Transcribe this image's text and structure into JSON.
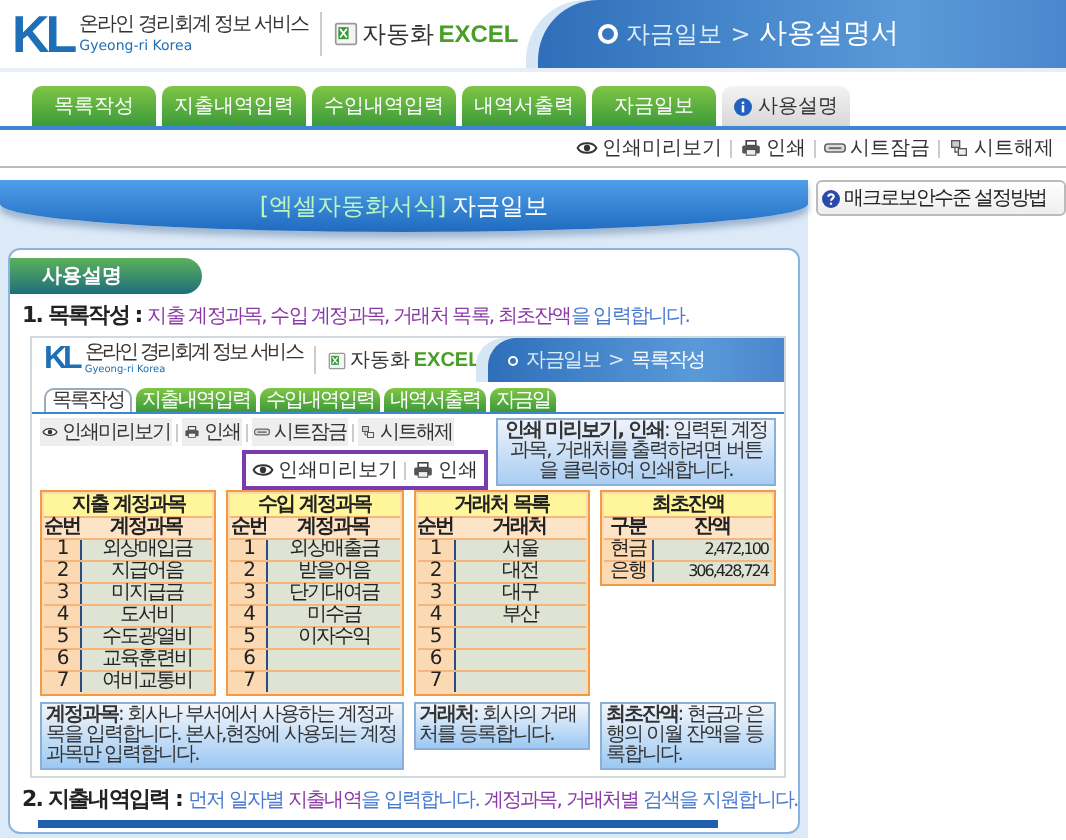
{
  "header": {
    "logo": "KL",
    "tagline": "온라인 경리회계 정보 서비스",
    "brand_sub": "Gyeong-ri Korea",
    "product_prefix": "자동화",
    "product_suffix": "EXCEL",
    "breadcrumb": [
      "자금일보",
      "사용설명서"
    ],
    "separator": ">"
  },
  "tabs": [
    {
      "label": "목록작성",
      "selected": false
    },
    {
      "label": "지출내역입력",
      "selected": false
    },
    {
      "label": "수입내역입력",
      "selected": false
    },
    {
      "label": "내역서출력",
      "selected": false
    },
    {
      "label": "자금일보",
      "selected": false
    },
    {
      "label": "사용설명",
      "selected": true
    }
  ],
  "toolbar": [
    {
      "label": "인쇄미리보기",
      "kind": "eye"
    },
    {
      "label": "인쇄",
      "kind": "printer"
    },
    {
      "label": "시트잠금",
      "kind": "lock"
    },
    {
      "label": "시트해제",
      "kind": "unlock"
    }
  ],
  "side_button": "매크로보안수준 설정방법",
  "banner": {
    "prefix": "[엑셀자동화서식]",
    "title": "자금일보"
  },
  "section_pill": "사용설명",
  "steps": [
    {
      "number": "1.",
      "title": "목록작성",
      "colon": ":",
      "description": [
        {
          "text": "지출 계정과목, 수입 계정과목, 거래처 목록, 최초잔액",
          "emphasis": true
        },
        {
          "text": "을 입력합니다.",
          "emphasis": false
        }
      ],
      "example": {
        "header": {
          "logo": "KL",
          "tagline": "온라인 경리회계 정보 서비스",
          "brand_sub": "Gyeong-ri Korea",
          "product_prefix": "자동화",
          "product_suffix": "EXCEL",
          "breadcrumb": [
            "자금일보",
            "목록작성"
          ],
          "separator": ">"
        },
        "tabs": [
          {
            "label": "목록작성",
            "selected": true
          },
          {
            "label": "지출내역입력",
            "selected": false
          },
          {
            "label": "수입내역입력",
            "selected": false
          },
          {
            "label": "내역서출력",
            "selected": false
          },
          {
            "label": "자금일",
            "selected": false
          }
        ],
        "toolbar": [
          {
            "label": "인쇄미리보기",
            "kind": "eye"
          },
          {
            "label": "인쇄",
            "kind": "printer"
          },
          {
            "label": "시트잠금",
            "kind": "lock"
          },
          {
            "label": "시트해제",
            "kind": "unlock"
          }
        ],
        "zoom_callout": [
          {
            "label": "인쇄미리보기",
            "kind": "eye"
          },
          {
            "label": "인쇄",
            "kind": "printer"
          }
        ],
        "tooltip": "**인쇄 미리보기, 인쇄**: 입력된 계정과목, 거래처를 출력하려면 버튼을 클릭하여 인쇄합니다.",
        "tables": [
          {
            "title": "지출 계정과목",
            "columns": [
              "순번",
              "계정과목"
            ],
            "rows": [
              [
                "1",
                "외상매입금"
              ],
              [
                "2",
                "지급어음"
              ],
              [
                "3",
                "미지급금"
              ],
              [
                "4",
                "도서비"
              ],
              [
                "5",
                "수도광열비"
              ],
              [
                "6",
                "교육훈련비"
              ],
              [
                "7",
                "여비교통비"
              ]
            ]
          },
          {
            "title": "수입 계정과목",
            "columns": [
              "순번",
              "계정과목"
            ],
            "rows": [
              [
                "1",
                "외상매출금"
              ],
              [
                "2",
                "받을어음"
              ],
              [
                "3",
                "단기대여금"
              ],
              [
                "4",
                "미수금"
              ],
              [
                "5",
                "이자수익"
              ],
              [
                "6"
              ],
              [
                "7"
              ]
            ]
          },
          {
            "title": "거래처 목록",
            "columns": [
              "순번",
              "거래처"
            ],
            "rows": [
              [
                "1",
                "서울"
              ],
              [
                "2",
                "대전"
              ],
              [
                "3",
                "대구"
              ],
              [
                "4",
                "부산"
              ],
              [
                "5"
              ],
              [
                "6"
              ],
              [
                "7"
              ]
            ]
          },
          {
            "title": "최초잔액",
            "columns": [
              "구분",
              "잔액"
            ],
            "rows": [
              [
                "현금",
                "2,472,100"
              ],
              [
                "은행",
                "306,428,724"
              ]
            ]
          }
        ],
        "notes": [
          "**계정과목**: 회사나 부서에서 사용하는 계정과목을 입력합니다. 본사,현장에 사용되는 계정과목만 입력합니다.",
          "**거래처**: 회사의 거래처를 등록합니다.",
          "**최초잔액**: 현금과 은행의 이월 잔액을 등록합니다."
        ]
      }
    },
    {
      "number": "2.",
      "title": "지출내역입력",
      "colon": ":",
      "description": [
        {
          "text": "먼저 일자별 ",
          "emphasis": false
        },
        {
          "text": "지출내역",
          "emphasis": true
        },
        {
          "text": "을 입력합니다. ",
          "emphasis": false
        },
        {
          "text": "계정과목, 거래처별",
          "emphasis": true
        },
        {
          "text": " 검색을 지원합니다.",
          "emphasis": false
        }
      ],
      "example_cut": true
    }
  ]
}
